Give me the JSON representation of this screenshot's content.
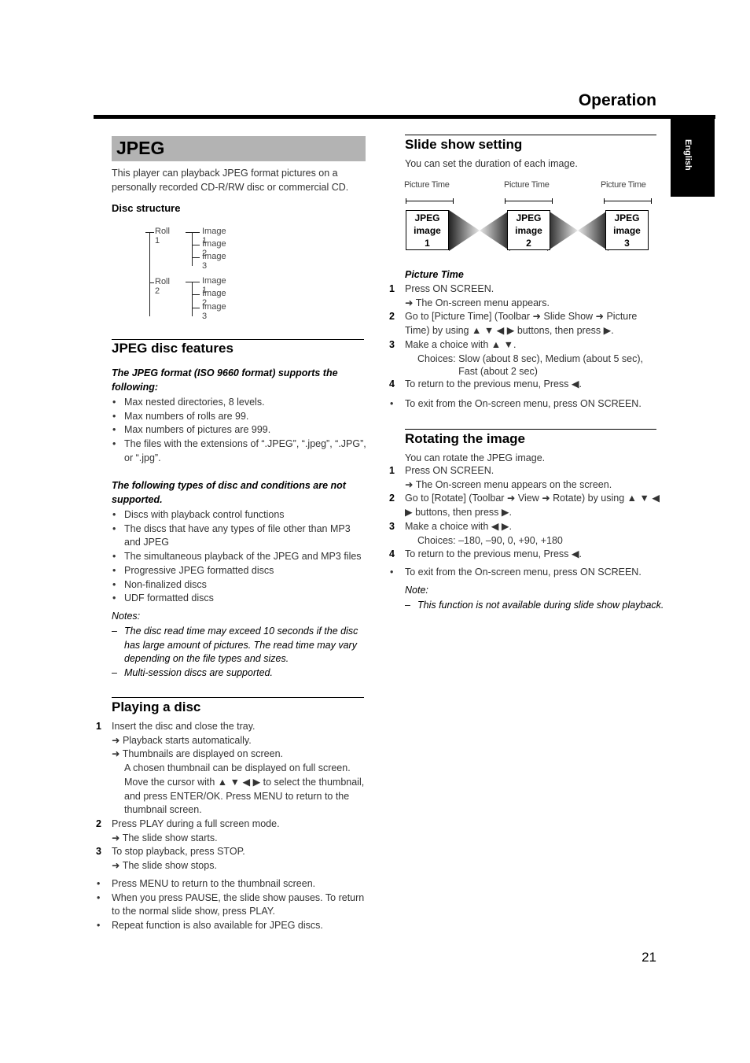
{
  "header": {
    "title": "Operation",
    "language_tab": "English"
  },
  "left": {
    "section_title": "JPEG",
    "intro": "This player can playback JPEG format pictures on a personally recorded CD-R/RW disc or commercial CD.",
    "disc_structure": {
      "label": "Disc structure",
      "rolls": [
        {
          "name": "Roll 1",
          "images": [
            "Image 1",
            "Image 2",
            "Image 3"
          ]
        },
        {
          "name": "Roll 2",
          "images": [
            "Image 1",
            "Image 2",
            "Image 3"
          ]
        }
      ]
    },
    "features": {
      "heading": "JPEG disc features",
      "supports_label": "The JPEG format (ISO 9660 format) supports the following:",
      "supports": [
        "Max nested directories, 8 levels.",
        "Max numbers of rolls are 99.",
        "Max numbers of pictures are 999.",
        "The files with the extensions of “.JPEG”, “.jpeg”, “.JPG”, or “.jpg”."
      ],
      "not_supported_label": "The following types of disc and conditions are not supported.",
      "not_supported": [
        "Discs with playback control functions",
        "The discs that have any types of file other than MP3 and JPEG",
        "The simultaneous playback of the JPEG and MP3 files",
        "Progressive JPEG formatted discs",
        "Non-finalized discs",
        "UDF formatted discs"
      ],
      "notes_label": "Notes:",
      "notes": [
        "The disc read time may exceed 10 seconds if the disc has large amount of pictures. The read time may vary depending on the file types and sizes.",
        "Multi-session discs are supported."
      ]
    },
    "playing": {
      "heading": "Playing a disc",
      "steps": [
        {
          "num": "1",
          "text": "Insert the disc and close the tray.",
          "results": [
            "➜ Playback starts automatically.",
            "➜ Thumbnails are displayed on screen."
          ],
          "extra": "A chosen thumbnail can be displayed on full screen. Move the cursor with ▲ ▼ ◀ ▶ to select the thumbnail, and press ENTER/OK. Press MENU to return to the thumbnail screen."
        },
        {
          "num": "2",
          "text": "Press PLAY during a full screen mode.",
          "results": [
            "➜ The slide show starts."
          ]
        },
        {
          "num": "3",
          "text": "To stop playback, press STOP.",
          "results": [
            "➜ The slide show stops."
          ]
        }
      ],
      "bullets": [
        "Press MENU to return to the thumbnail screen.",
        "When you press PAUSE, the slide show pauses. To return to the normal slide show, press PLAY.",
        "Repeat function is also available for JPEG discs."
      ]
    }
  },
  "right": {
    "slideshow": {
      "heading": "Slide show setting",
      "intro": "You can set the duration of each image.",
      "diagram": {
        "time_label": "Picture Time",
        "boxes": [
          {
            "line1": "JPEG",
            "line2": "image",
            "line3": "1"
          },
          {
            "line1": "JPEG",
            "line2": "image",
            "line3": "2"
          },
          {
            "line1": "JPEG",
            "line2": "image",
            "line3": "3"
          }
        ]
      },
      "subheading": "Picture Time",
      "steps": [
        {
          "num": "1",
          "text": "Press ON SCREEN.",
          "results": [
            "➜ The On-screen menu appears."
          ]
        },
        {
          "num": "2",
          "text": "Go to [Picture Time] (Toolbar ➜ Slide Show ➜ Picture Time) by using ▲ ▼ ◀ ▶ buttons, then press ▶."
        },
        {
          "num": "3",
          "text": "Make a choice with ▲ ▼.",
          "choices_label": "Choices:",
          "choices": "Slow (about 8 sec), Medium (about 5 sec), Fast (about 2 sec)"
        },
        {
          "num": "4",
          "text": "To return to the previous menu, Press ◀."
        }
      ],
      "bullet": "To exit from the On-screen menu, press ON SCREEN."
    },
    "rotating": {
      "heading": "Rotating the image",
      "intro": "You can rotate the JPEG image.",
      "steps": [
        {
          "num": "1",
          "text": "Press ON SCREEN.",
          "results": [
            "➜ The On-screen menu appears on the screen."
          ]
        },
        {
          "num": "2",
          "text": "Go to [Rotate] (Toolbar ➜ View ➜ Rotate) by using ▲ ▼ ◀ ▶ buttons, then press ▶."
        },
        {
          "num": "3",
          "text": "Make a choice with ◀ ▶.",
          "choices": "Choices: –180, –90, 0, +90, +180"
        },
        {
          "num": "4",
          "text": "To return to the previous menu, Press ◀."
        }
      ],
      "bullet": "To exit from the On-screen menu, press ON SCREEN.",
      "note_label": "Note:",
      "note": "This function is not available during slide show playback."
    }
  },
  "footer": {
    "page_number": "21"
  }
}
